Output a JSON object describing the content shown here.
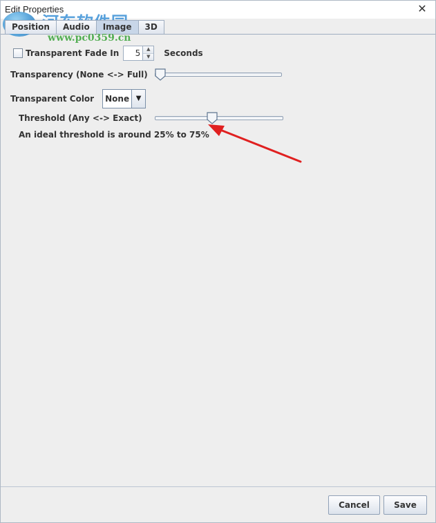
{
  "window": {
    "title": "Edit Properties",
    "close_glyph": "✕"
  },
  "watermark": {
    "text": "河东软件园",
    "url": "www.pc0359.cn"
  },
  "tabs": [
    {
      "label": "Position",
      "active": false
    },
    {
      "label": "Audio",
      "active": false
    },
    {
      "label": "Image",
      "active": true
    },
    {
      "label": "3D",
      "active": false
    }
  ],
  "fade": {
    "checkbox_label": "Transparent Fade In",
    "checked": false,
    "value": "5",
    "unit": "Seconds"
  },
  "transparency": {
    "label": "Transparency (None <-> Full)",
    "level": 0
  },
  "color": {
    "label": "Transparent Color",
    "selected": "None"
  },
  "threshold": {
    "label": "Threshold (Any <-> Exact)",
    "level": 0.45,
    "hint": "An ideal threshold is around 25%  to 75%"
  },
  "annotation": {
    "arrow_color": "#e02020"
  },
  "footer": {
    "cancel_label": "Cancel",
    "save_label": "Save"
  }
}
